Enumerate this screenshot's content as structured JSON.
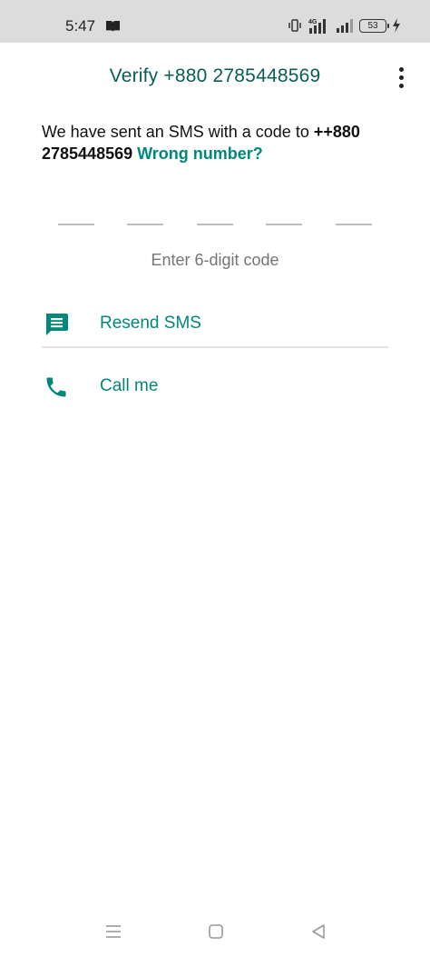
{
  "status_bar": {
    "time": "5:47",
    "network": "4G",
    "battery_level": "53",
    "icons": [
      "book-icon",
      "vibrate-icon",
      "4g-signal-icon",
      "signal-bars-icon",
      "battery-icon",
      "charging-bolt-icon"
    ]
  },
  "header": {
    "title": "Verify +880 2785448569",
    "menu_icon": "more-vertical-icon"
  },
  "message": {
    "text": "We have sent an SMS with a code to ",
    "phone": "++880 2785448569",
    "separator": " ",
    "wrong_number_link": "Wrong number?"
  },
  "code_input": {
    "slot_count": 5,
    "hint": "Enter 6-digit code"
  },
  "options": [
    {
      "label": "Resend SMS",
      "icon": "message-icon"
    },
    {
      "label": "Call me",
      "icon": "phone-icon"
    }
  ],
  "nav": {
    "icons": [
      "menu-icon",
      "home-icon",
      "back-icon"
    ]
  },
  "colors": {
    "title": "#075e54",
    "accent": "#00897b",
    "status_bar": "#dcdcdc",
    "hint": "#757575"
  }
}
